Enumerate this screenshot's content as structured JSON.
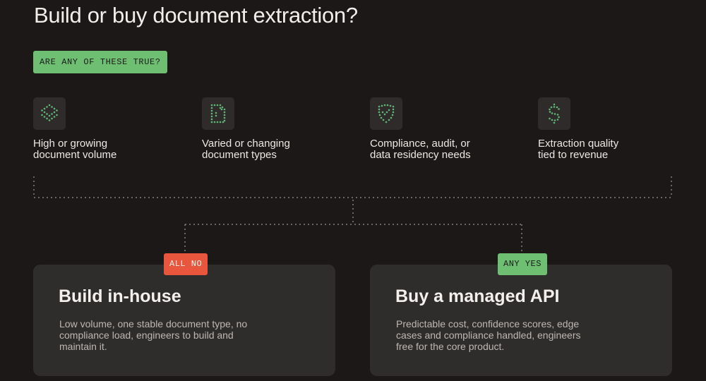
{
  "title": "Build or buy document extraction?",
  "question": "ARE ANY OF THESE TRUE?",
  "criteria": [
    {
      "icon": "layers-icon",
      "line1": "High or growing",
      "line2": "document volume"
    },
    {
      "icon": "document-icon",
      "line1": "Varied or changing",
      "line2": "document types"
    },
    {
      "icon": "shield-check-icon",
      "line1": "Compliance, audit, or",
      "line2": "data residency needs"
    },
    {
      "icon": "dollar-icon",
      "line1": "Extraction quality",
      "line2": "tied to revenue"
    }
  ],
  "outcomes": {
    "build": {
      "tag": "ALL NO",
      "title": "Build in-house",
      "desc_lines": [
        "Low volume, one stable document type, no",
        "compliance load, engineers to build and",
        "maintain it."
      ]
    },
    "buy": {
      "tag": "ANY YES",
      "title": "Buy a managed API",
      "desc_lines": [
        "Predictable cost, confidence scores, edge",
        "cases and compliance handled, engineers",
        "free for the core product."
      ]
    }
  },
  "colors": {
    "background": "#1c1818",
    "accent_green": "#6fbf73",
    "accent_red": "#e8563e",
    "icon_dots": "#5fb876",
    "card": "#2f2c2c"
  }
}
